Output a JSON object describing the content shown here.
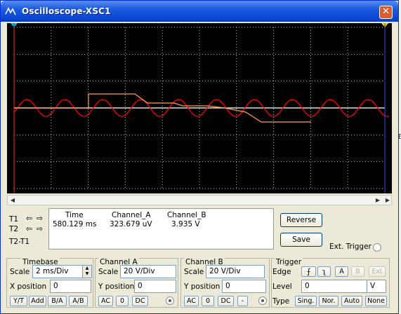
{
  "window": {
    "title": "Oscilloscope-XSC1",
    "close_glyph": "✕",
    "side_marker": "B"
  },
  "scope": {
    "background": "#000000",
    "grid_color": "#ffffff",
    "channel_a_color": "#ff0000",
    "channel_b_color": "#ffa050",
    "cursor1_marker": "1",
    "cursor2_marker": "2",
    "cursor1_color": "#00c0ff",
    "cursor2_color": "#ffd800"
  },
  "scrollbar": {
    "left_arrow": "◀",
    "right_arrow": "▶"
  },
  "readout": {
    "row_labels": [
      "T1",
      "T2",
      "T2-T1"
    ],
    "headers": [
      "Time",
      "Channel_A",
      "Channel_B"
    ],
    "t1_values": [
      "580.129 ms",
      "323.679 uV",
      "3.935 V"
    ]
  },
  "buttons": {
    "reverse": "Reverse",
    "save": "Save",
    "ext_trigger": "Ext. Trigger"
  },
  "timebase": {
    "title": "Timebase",
    "scale_label": "Scale",
    "scale_value": "2 ms/Div",
    "xpos_label": "X position",
    "xpos_value": "0",
    "modes": [
      "Y/T",
      "Add",
      "B/A",
      "A/B"
    ]
  },
  "channel_a": {
    "title": "Channel A",
    "scale_label": "Scale",
    "scale_value": "20  V/Div",
    "ypos_label": "Y position",
    "ypos_value": "0",
    "coupling": [
      "AC",
      "0",
      "DC"
    ]
  },
  "channel_b": {
    "title": "Channel B",
    "scale_label": "Scale",
    "scale_value": "20  V/Div",
    "ypos_label": "Y position",
    "ypos_value": "0",
    "coupling": [
      "AC",
      "0",
      "DC",
      "-"
    ]
  },
  "trigger": {
    "title": "Trigger",
    "edge_label": "Edge",
    "sources": [
      "A",
      "B",
      "Ext"
    ],
    "level_label": "Level",
    "level_value": "0",
    "level_unit": "V",
    "type_label": "Type",
    "types": [
      "Sing.",
      "Nor.",
      "Auto",
      "None"
    ]
  }
}
